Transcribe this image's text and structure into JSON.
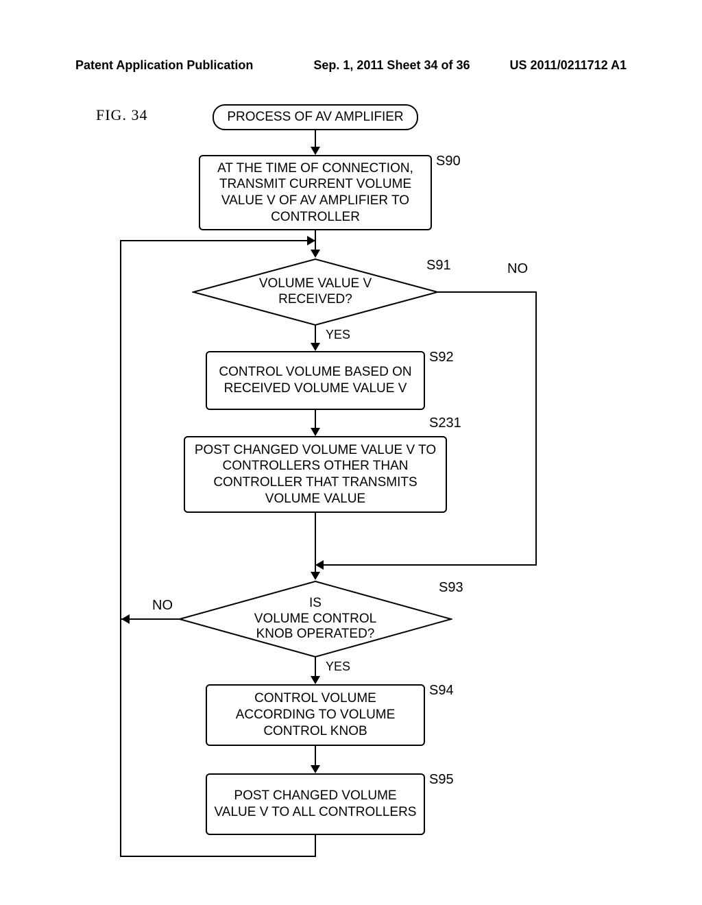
{
  "header": {
    "left": "Patent Application Publication",
    "mid": "Sep. 1, 2011  Sheet 34 of 36",
    "right": "US 2011/0211712 A1"
  },
  "figure_label": "FIG.  34",
  "nodes": {
    "start": "PROCESS OF AV AMPLIFIER",
    "s90": "AT THE TIME OF CONNECTION, TRANSMIT CURRENT VOLUME VALUE V OF AV AMPLIFIER TO CONTROLLER",
    "s91": "VOLUME VALUE V RECEIVED?",
    "s92": "CONTROL VOLUME BASED ON RECEIVED VOLUME VALUE V",
    "s231": "POST CHANGED VOLUME VALUE V TO CONTROLLERS OTHER THAN CONTROLLER THAT TRANSMITS VOLUME VALUE",
    "s93": "IS\nVOLUME CONTROL\nKNOB OPERATED?",
    "s94": "CONTROL VOLUME ACCORDING TO VOLUME CONTROL KNOB",
    "s95": "POST CHANGED VOLUME VALUE V TO ALL CONTROLLERS"
  },
  "step_labels": {
    "s90": "S90",
    "s91": "S91",
    "s92": "S92",
    "s231": "S231",
    "s93": "S93",
    "s94": "S94",
    "s95": "S95"
  },
  "branch_labels": {
    "yes": "YES",
    "no": "NO"
  },
  "chart_data": {
    "type": "flowchart",
    "title": "PROCESS OF AV AMPLIFIER",
    "nodes": [
      {
        "id": "start",
        "kind": "terminator",
        "text": "PROCESS OF AV AMPLIFIER"
      },
      {
        "id": "S90",
        "kind": "process",
        "text": "AT THE TIME OF CONNECTION, TRANSMIT CURRENT VOLUME VALUE V OF AV AMPLIFIER TO CONTROLLER"
      },
      {
        "id": "S91",
        "kind": "decision",
        "text": "VOLUME VALUE V RECEIVED?"
      },
      {
        "id": "S92",
        "kind": "process",
        "text": "CONTROL VOLUME BASED ON RECEIVED VOLUME VALUE V"
      },
      {
        "id": "S231",
        "kind": "process",
        "text": "POST CHANGED VOLUME VALUE V TO CONTROLLERS OTHER THAN CONTROLLER THAT TRANSMITS VOLUME VALUE"
      },
      {
        "id": "S93",
        "kind": "decision",
        "text": "IS VOLUME CONTROL KNOB OPERATED?"
      },
      {
        "id": "S94",
        "kind": "process",
        "text": "CONTROL VOLUME ACCORDING TO VOLUME CONTROL KNOB"
      },
      {
        "id": "S95",
        "kind": "process",
        "text": "POST CHANGED VOLUME VALUE V TO ALL CONTROLLERS"
      }
    ],
    "edges": [
      {
        "from": "start",
        "to": "S90"
      },
      {
        "from": "S90",
        "to": "S91"
      },
      {
        "from": "S91",
        "to": "S92",
        "label": "YES"
      },
      {
        "from": "S91",
        "to": "S93",
        "label": "NO",
        "note": "bypass S92/S231, join above S93"
      },
      {
        "from": "S92",
        "to": "S231"
      },
      {
        "from": "S231",
        "to": "S93"
      },
      {
        "from": "S93",
        "to": "S94",
        "label": "YES"
      },
      {
        "from": "S93",
        "to": "S91",
        "label": "NO",
        "note": "loop back to point above S91"
      },
      {
        "from": "S94",
        "to": "S95"
      },
      {
        "from": "S95",
        "to": "S91",
        "note": "loop back to point above S91"
      }
    ]
  }
}
